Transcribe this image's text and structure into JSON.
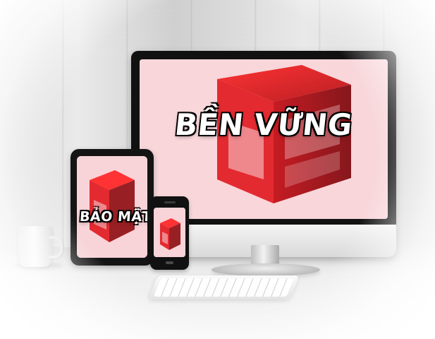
{
  "scene": {
    "monitor": {
      "label": "BỀN VỮNG"
    },
    "tablet": {
      "label": "BẢO MẬT"
    }
  },
  "icons": {
    "logo": "25-logo-icon"
  },
  "colors": {
    "screen_bg": "#f8d6da",
    "logo_red": "#e11b22",
    "logo_dark": "#8f1015",
    "text_white": "#ffffff",
    "text_outline": "#000000"
  }
}
